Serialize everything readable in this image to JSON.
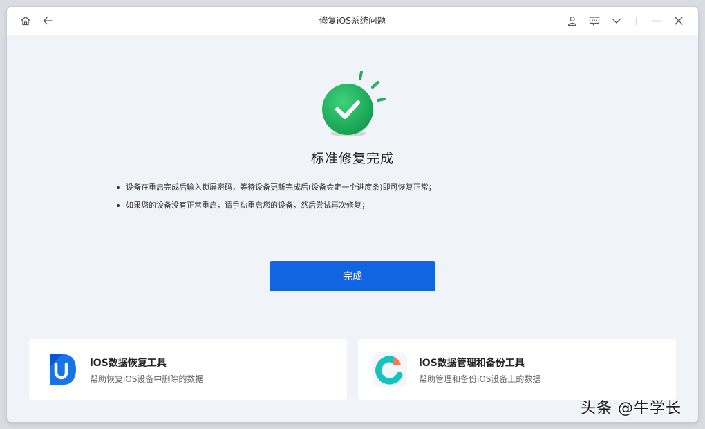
{
  "window": {
    "title": "修复iOS系统问题",
    "icons": [
      "home-icon",
      "back-icon",
      "user-icon",
      "chat-icon",
      "chevron-down-icon",
      "minimize-icon",
      "close-icon"
    ]
  },
  "result": {
    "status_icon": "success-check-icon",
    "heading": "标准修复完成",
    "notes": [
      "设备在重启完成后输入锁屏密码，等待设备更新完成后(设备会走一个进度条)即可恢复正常；",
      "如果您的设备没有正常重启，请手动重启您的设备，然后尝试再次修复；"
    ],
    "done_label": "完成"
  },
  "products": [
    {
      "title": "iOS数据恢复工具",
      "subtitle": "帮助恢复iOS设备中删除的数据",
      "icon": "ultdata-logo-icon"
    },
    {
      "title": "iOS数据管理和备份工具",
      "subtitle": "帮助管理和备份iOS设备上的数据",
      "icon": "icarefone-logo-icon"
    }
  ],
  "watermark": "头条 @牛学长",
  "colors": {
    "accent": "#1265e2",
    "success": "#1fb15a",
    "background": "#f0f3f8"
  }
}
